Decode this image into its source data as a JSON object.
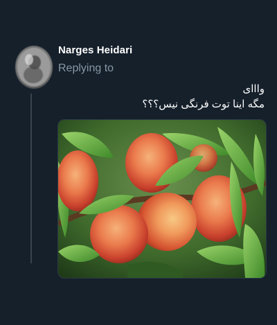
{
  "reply": {
    "author_name": "Narges Heidari",
    "replying_to_label": "Replying to",
    "text_line_1": "وااای",
    "text_line_2": "مگه اینا توت فرنگی نیس؟؟؟"
  },
  "colors": {
    "background": "#15202b",
    "text_primary": "#ffffff",
    "text_secondary": "#8899a6",
    "thread_line": "#38444d"
  },
  "icons": {
    "avatar": "user-avatar"
  }
}
